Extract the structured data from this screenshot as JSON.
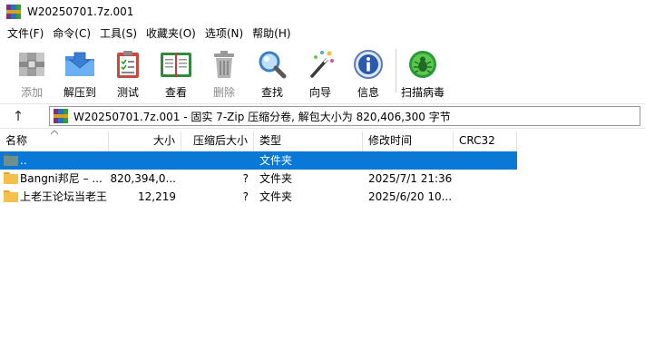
{
  "window": {
    "title": "W20250701.7z.001"
  },
  "menu": [
    "文件(F)",
    "命令(C)",
    "工具(S)",
    "收藏夹(O)",
    "选项(N)",
    "帮助(H)"
  ],
  "toolbar": {
    "buttons": [
      {
        "label": "添加",
        "icon": "add-archive-icon",
        "enabled": false
      },
      {
        "label": "解压到",
        "icon": "extract-folder-icon",
        "enabled": true
      },
      {
        "label": "测试",
        "icon": "test-clipboard-icon",
        "enabled": true
      },
      {
        "label": "查看",
        "icon": "view-book-icon",
        "enabled": true
      },
      {
        "label": "删除",
        "icon": "delete-trash-icon",
        "enabled": false
      },
      {
        "label": "查找",
        "icon": "find-magnifier-icon",
        "enabled": true
      },
      {
        "label": "向导",
        "icon": "wizard-wand-icon",
        "enabled": true
      },
      {
        "label": "信息",
        "icon": "info-icon",
        "enabled": true
      },
      {
        "label": "扫描病毒",
        "icon": "virus-scan-icon",
        "enabled": true
      }
    ]
  },
  "address": {
    "up_symbol": "↑",
    "path_text": "W20250701.7z.001 - 固实 7-Zip 压缩分卷, 解包大小为 820,406,300 字节"
  },
  "columns": {
    "name": "名称",
    "size": "大小",
    "packed": "压缩后大小",
    "type": "类型",
    "modified": "修改时间",
    "crc": "CRC32"
  },
  "rows": [
    {
      "name": "..",
      "size": "",
      "packed": "",
      "type": "文件夹",
      "modified": "",
      "crc": "",
      "selected": true,
      "folder_color": "#6e8f8c"
    },
    {
      "name": "Bangni邦尼 – ...",
      "size": "820,394,0...",
      "packed": "?",
      "type": "文件夹",
      "modified": "2025/7/1 21:36",
      "crc": "",
      "selected": false,
      "folder_color": "#f4c04a"
    },
    {
      "name": "上老王论坛当老王",
      "size": "12,219",
      "packed": "?",
      "type": "文件夹",
      "modified": "2025/6/20 10...",
      "crc": "",
      "selected": false,
      "folder_color": "#f4c04a"
    }
  ],
  "colors": {
    "selection": "#0a78d7",
    "folder": "#f4c04a"
  }
}
